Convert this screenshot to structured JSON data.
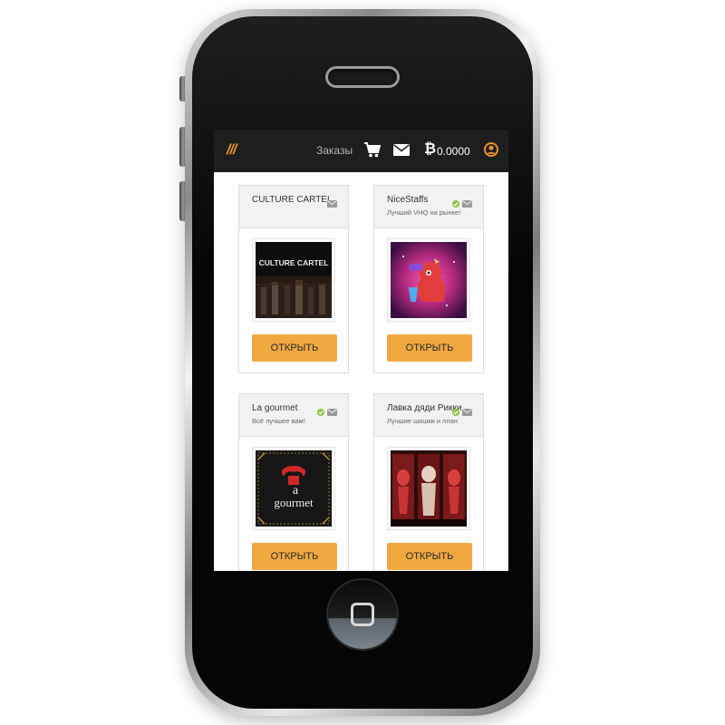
{
  "navbar": {
    "menu_label": "///",
    "orders_label": "Заказы",
    "btc_symbol": "₿",
    "btc_balance": "0.0000",
    "icons": [
      "cart-icon",
      "mail-icon",
      "bitcoin-icon",
      "user-icon"
    ],
    "accent_color": "#e8932c"
  },
  "shops": [
    {
      "name": "CULTURE CARTEL",
      "description": "",
      "logo_text": "CULTURE CARTEL",
      "verified": false,
      "button_label": "ОТКРЫТЬ"
    },
    {
      "name": "NiceStaffs",
      "description": "Лучший VHQ на рынке!",
      "logo_text": "",
      "verified": true,
      "button_label": "ОТКРЫТЬ"
    },
    {
      "name": "La gourmet",
      "description": "Всё лучшее вам!",
      "logo_text_top": "a",
      "logo_text_bottom": "gourmet",
      "verified": true,
      "button_label": "ОТКРЫТЬ"
    },
    {
      "name": "Лавка дяди Рикки",
      "description": "Лучшие шишки и план",
      "logo_text": "",
      "verified": true,
      "button_label": "ОТКРЫТЬ"
    }
  ],
  "colors": {
    "button_bg": "#f0a840",
    "topbar_bg": "#1e1e1e",
    "verified": "#8cc63f"
  }
}
